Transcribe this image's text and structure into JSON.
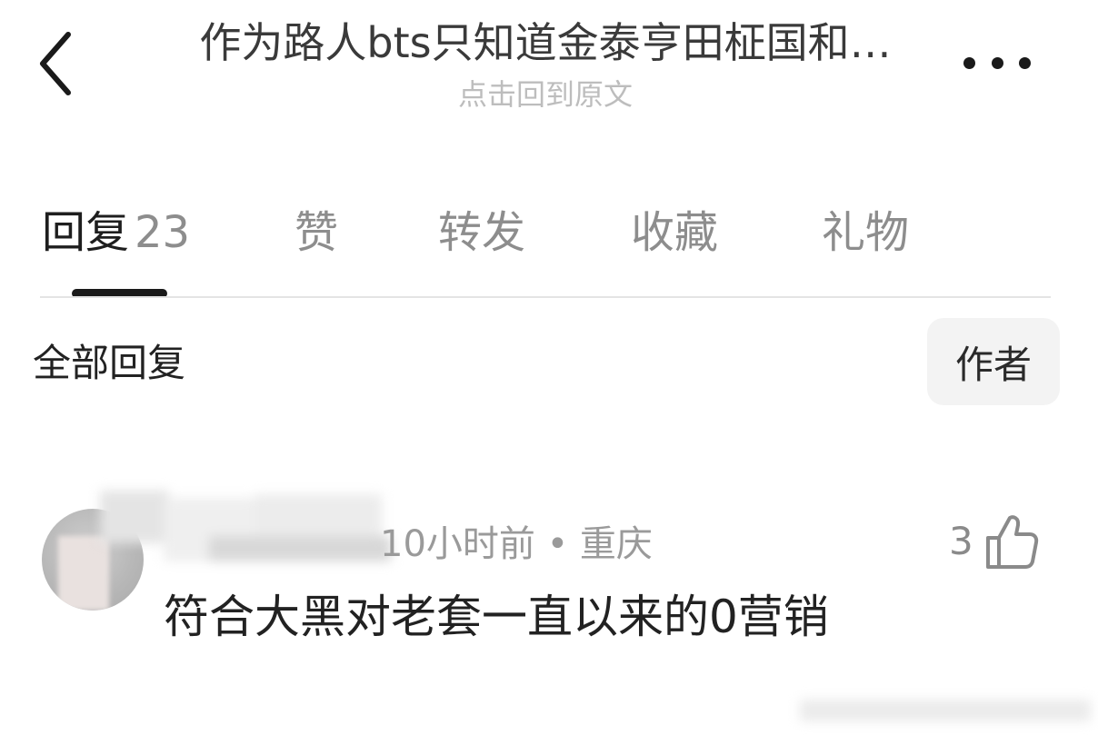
{
  "header": {
    "title": "作为路人bts只知道金泰亨田柾国和…",
    "subtitle": "点击回到原文",
    "back_icon": "chevron-left-icon",
    "more_icon": "more-horizontal-icon"
  },
  "tabs": [
    {
      "label": "回复",
      "count": "23",
      "active": true
    },
    {
      "label": "赞",
      "count": ""
    },
    {
      "label": "转发",
      "count": ""
    },
    {
      "label": "收藏",
      "count": ""
    },
    {
      "label": "礼物",
      "count": ""
    }
  ],
  "filter": {
    "section_label": "全部回复",
    "author_button": "作者"
  },
  "comments": [
    {
      "meta": "10小时前 • 重庆",
      "text": "符合大黑对老套一直以来的0营销",
      "likes": "3",
      "like_icon": "thumbs-up-icon"
    }
  ],
  "colors": {
    "text_primary": "#222222",
    "text_secondary": "#8d8d8d",
    "subtitle": "#bdbdbd",
    "indicator": "#1a1a1a",
    "divider": "#e4e4e4",
    "author_button_bg": "#f3f3f3"
  }
}
